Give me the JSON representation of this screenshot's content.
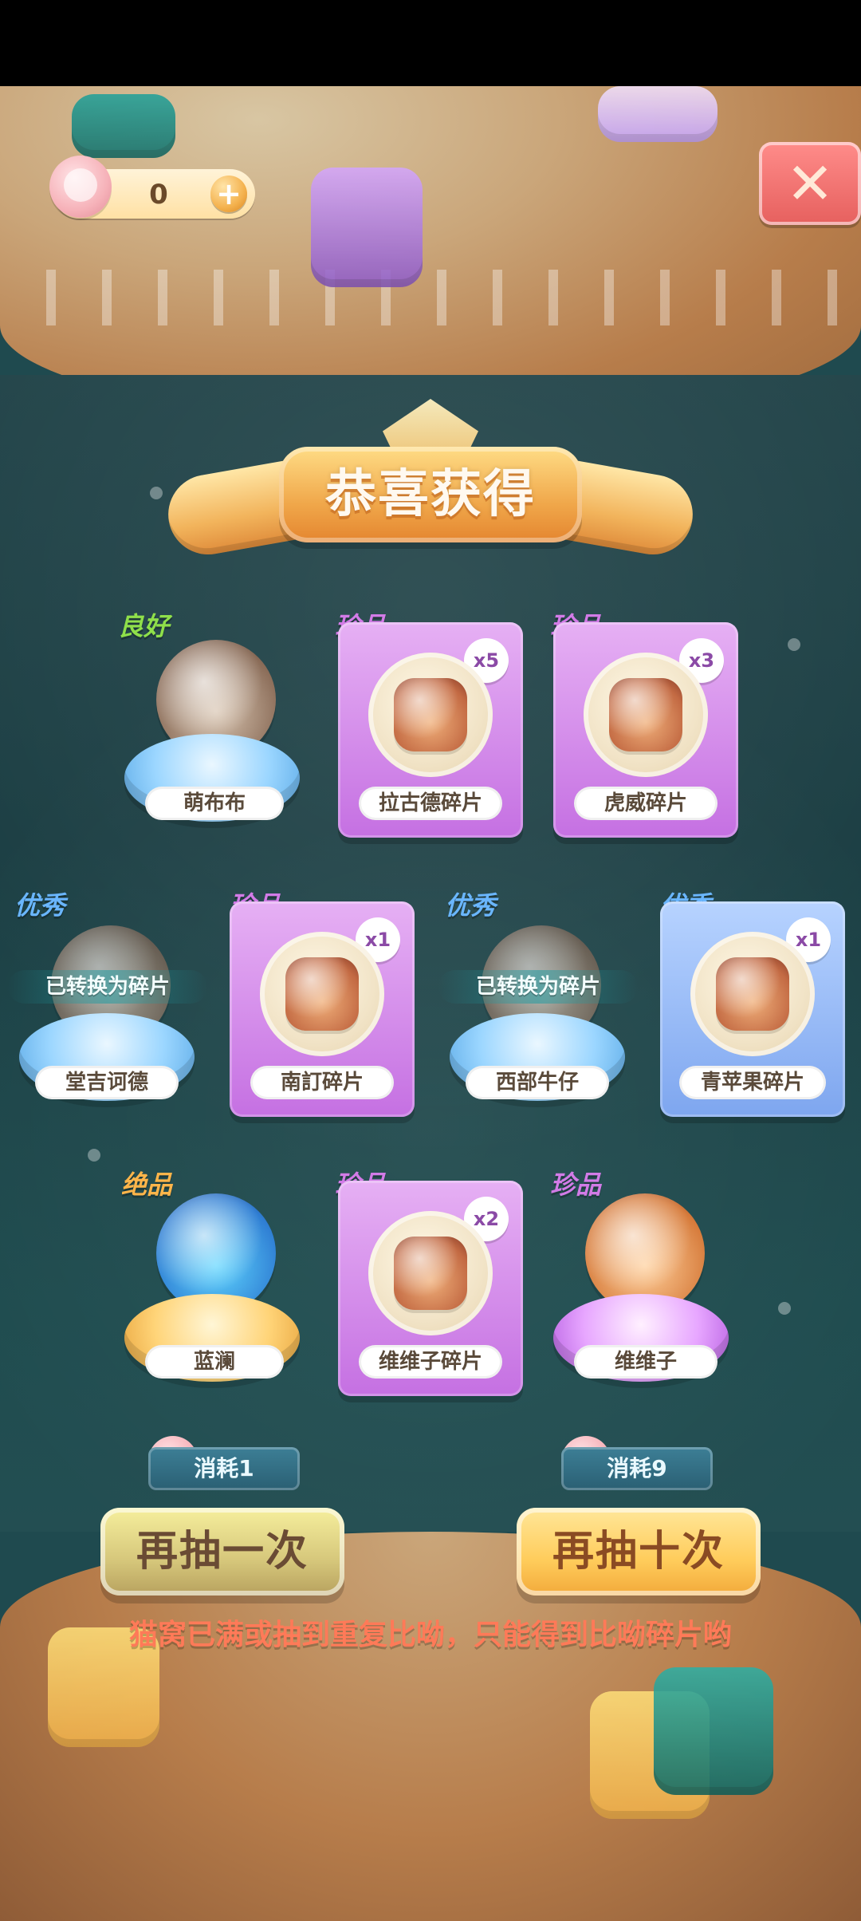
{
  "status_bar": {},
  "top_ui": {
    "currency_value": "0",
    "plus_label": "+",
    "close_label": "✕"
  },
  "title": {
    "text": "恭喜获得"
  },
  "rewards": {
    "row1": [
      {
        "rarity": "良好",
        "name": "萌布布",
        "type": "character",
        "pedestal": "blue"
      },
      {
        "rarity": "珍品",
        "name": "拉古德碎片",
        "type": "shard",
        "count": "x5",
        "card_color": "purple"
      },
      {
        "rarity": "珍品",
        "name": "虎威碎片",
        "type": "shard",
        "count": "x3",
        "card_color": "purple"
      }
    ],
    "row2": [
      {
        "rarity": "优秀",
        "name": "堂吉诃德",
        "type": "character",
        "pedestal": "blue",
        "converted_text": "已转换为碎片"
      },
      {
        "rarity": "珍品",
        "name": "南訂碎片",
        "type": "shard",
        "count": "x1",
        "card_color": "purple"
      },
      {
        "rarity": "优秀",
        "name": "西部牛仔",
        "type": "character",
        "pedestal": "blue",
        "converted_text": "已转换为碎片"
      },
      {
        "rarity": "优秀",
        "name": "青苹果碎片",
        "type": "shard",
        "count": "x1",
        "card_color": "blue"
      }
    ],
    "row3": [
      {
        "rarity": "绝品",
        "name": "蓝澜",
        "type": "character",
        "pedestal": "gold"
      },
      {
        "rarity": "珍品",
        "name": "维维子碎片",
        "type": "shard",
        "count": "x2",
        "card_color": "purple"
      },
      {
        "rarity": "珍品",
        "name": "维维子",
        "type": "character",
        "pedestal": "purple"
      }
    ]
  },
  "costs": {
    "once": "消耗1",
    "ten": "消耗9"
  },
  "actions": {
    "draw_once": "再抽一次",
    "draw_ten": "再抽十次"
  },
  "notice": {
    "text": "猫窝已满或抽到重复比呦，只能得到比呦碎片哟"
  },
  "icons": {
    "paw": "paw-icon",
    "plus": "plus-icon",
    "close": "close-icon",
    "cost": "paw-icon"
  },
  "colors": {
    "good": "#8fe04a",
    "rare": "#d27be7",
    "excellent": "#6ab6ff",
    "legend": "#ffb54a",
    "notice": "#ff7a58"
  }
}
